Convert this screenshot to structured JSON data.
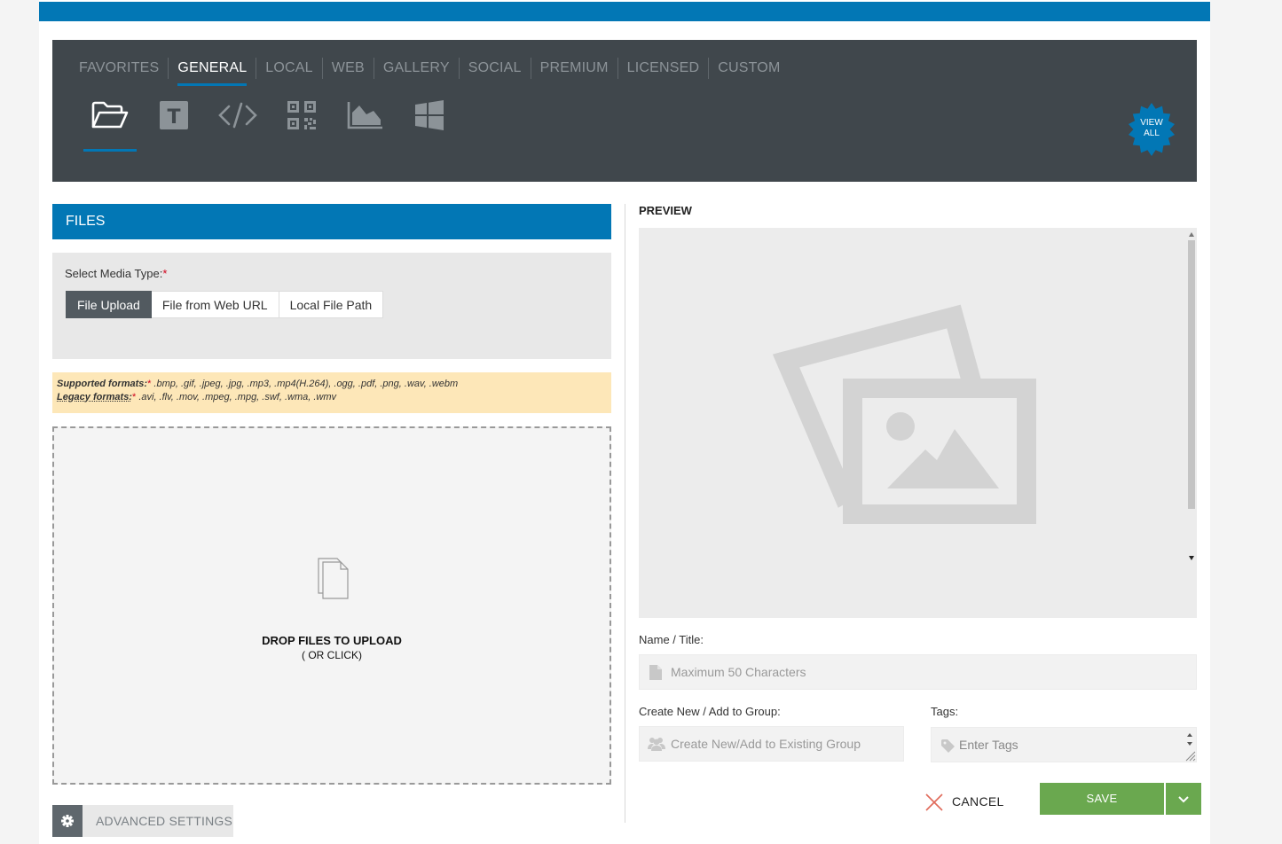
{
  "tabs": [
    "FAVORITES",
    "GENERAL",
    "LOCAL",
    "WEB",
    "GALLERY",
    "SOCIAL",
    "PREMIUM",
    "LICENSED",
    "CUSTOM"
  ],
  "active_tab": "GENERAL",
  "tool_icons": [
    "folder-open-icon",
    "text-icon",
    "code-icon",
    "qr-code-icon",
    "area-chart-icon",
    "windows-icon"
  ],
  "view_all": {
    "line1": "VIEW",
    "line2": "ALL"
  },
  "files": {
    "header": "FILES",
    "media_type_label": "Select Media Type:",
    "required_mark": "*",
    "options": [
      "File Upload",
      "File from Web URL",
      "Local File Path"
    ],
    "selected_option": "File Upload"
  },
  "formats": {
    "supported_label": "Supported formats:",
    "supported_list": ".bmp, .gif, .jpeg, .jpg, .mp3, .mp4(H.264), .ogg, .pdf, .png, .wav, .webm",
    "legacy_label": "Legacy formats:",
    "legacy_list": ".avi, .flv, .mov, .mpeg, .mpg, .swf, .wma, .wmv"
  },
  "dropzone": {
    "title": "DROP FILES TO UPLOAD",
    "subtitle": "( OR CLICK)"
  },
  "advanced_settings": "ADVANCED SETTINGS",
  "preview": {
    "title": "PREVIEW"
  },
  "name_field": {
    "label": "Name / Title:",
    "placeholder": "Maximum 50 Characters"
  },
  "group_field": {
    "label": "Create New / Add to Group:",
    "placeholder": "Create New/Add to Existing Group"
  },
  "tags_field": {
    "label": "Tags:",
    "placeholder": "Enter Tags"
  },
  "actions": {
    "cancel": "CANCEL",
    "save": "SAVE"
  },
  "colors": {
    "accent": "#0277b5",
    "dark_panel": "#40474c",
    "save": "#6aa84f",
    "warning_bg": "#fde7b8",
    "required": "#d0021b"
  }
}
